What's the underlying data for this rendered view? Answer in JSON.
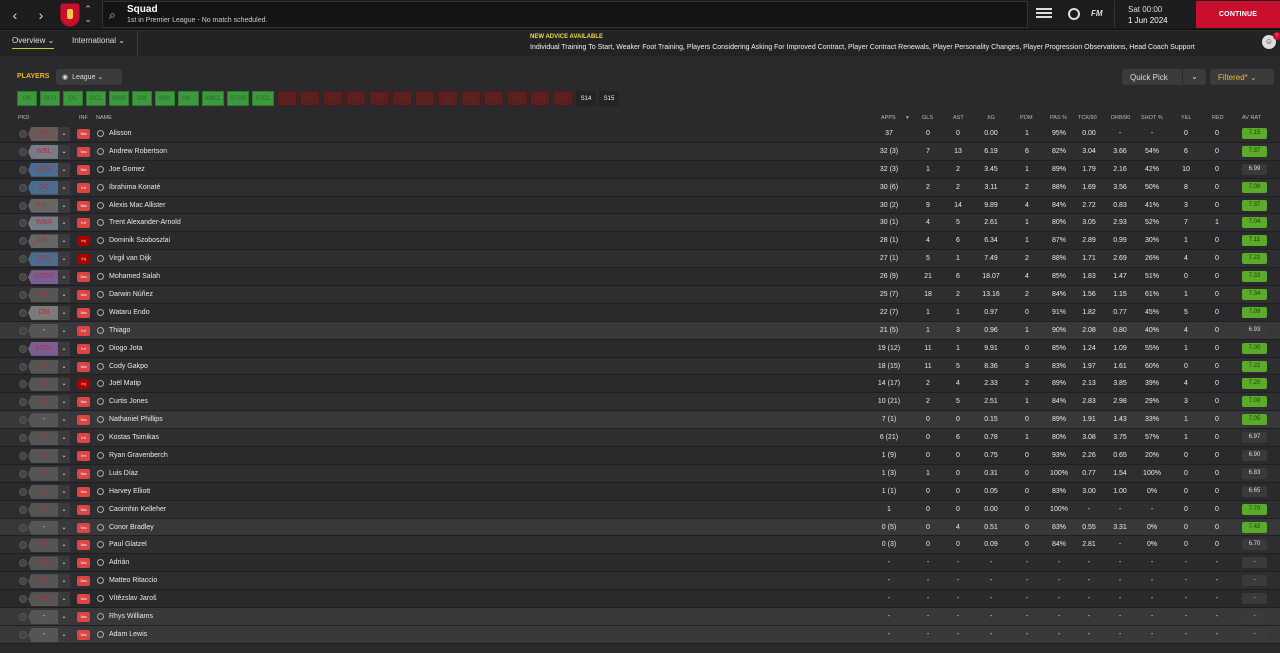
{
  "topbar": {
    "title": "Squad",
    "subtitle": "1st in Premier League - No match scheduled.",
    "time": "Sat 00:00",
    "date": "1 Jun 2024",
    "continue_label": "CONTINUE",
    "fm_label": "FM"
  },
  "subbar": {
    "tab_overview": "Overview ⌄",
    "tab_international": "International ⌄",
    "advice_title": "NEW ADVICE AVAILABLE",
    "advice_text": "Individual Training To Start, Weaker Foot Training, Players Considering Asking For Improved Contract, Player Contract Renewals, Player Personality Changes, Player Progression Observations, Head Coach Support"
  },
  "filters": {
    "players_label": "PLAYERS",
    "league_label": "League ⌄",
    "quick_pick": "Quick Pick",
    "filtered": "Filtered* ⌄",
    "positions": [
      "GK",
      "DCR",
      "DC",
      "DCL",
      "WBR",
      "DM",
      "WBL",
      "AM...",
      "AMCL",
      "STCR",
      "STCL",
      "S1",
      "S2",
      "S3",
      "S4",
      "S5",
      "S6",
      "S7",
      "S8",
      "S9",
      "S10",
      "S11",
      "S12",
      "S13",
      "S14",
      "S15"
    ]
  },
  "columns": {
    "pkd": "PKD",
    "inf": "INF",
    "name": "NAME",
    "apps": "APPS",
    "gls": "GLS",
    "ast": "AST",
    "xg": "XG",
    "pom": "POM",
    "pas": "PAS %",
    "tck": "TCK/90",
    "drb": "DRB/90",
    "shot": "SHOT %",
    "yel": "YEL",
    "red": "RED",
    "avrat": "AV RAT"
  },
  "colors": {
    "rating_good": "#5aab2a",
    "accent_red": "#c8102e",
    "accent_yellow": "#e6b822"
  },
  "rows": [
    {
      "pos": "GK",
      "inf": "Vac",
      "name": "Alisson",
      "apps": "37",
      "gls": "0",
      "ast": "0",
      "xg": "0.00",
      "pom": "1",
      "pas": "95%",
      "tck": "0.00",
      "drb": "-",
      "shot": "-",
      "yel": "0",
      "red": "0",
      "rat": "7.15"
    },
    {
      "pos": "WBL",
      "inf": "Vac",
      "name": "Andrew Robertson",
      "apps": "32 (3)",
      "gls": "7",
      "ast": "13",
      "xg": "6.19",
      "pom": "6",
      "pas": "82%",
      "tck": "3.04",
      "drb": "3.66",
      "shot": "54%",
      "yel": "6",
      "red": "0",
      "rat": "7.37"
    },
    {
      "pos": "DCR",
      "inf": "Vac",
      "name": "Joe Gomez",
      "apps": "32 (3)",
      "gls": "1",
      "ast": "2",
      "xg": "3.45",
      "pom": "1",
      "pas": "89%",
      "tck": "1.79",
      "drb": "2.16",
      "shot": "42%",
      "yel": "10",
      "red": "0",
      "rat": "6.99"
    },
    {
      "pos": "DC",
      "inf": "Int",
      "name": "Ibrahima Konaté",
      "apps": "30 (6)",
      "gls": "2",
      "ast": "2",
      "xg": "3.11",
      "pom": "2",
      "pas": "88%",
      "tck": "1.69",
      "drb": "3.56",
      "shot": "50%",
      "yel": "8",
      "red": "0",
      "rat": "7.08"
    },
    {
      "pos": "AM...",
      "inf": "Vac",
      "name": "Alexis Mac Allister",
      "apps": "30 (2)",
      "gls": "9",
      "ast": "14",
      "xg": "9.89",
      "pom": "4",
      "pas": "84%",
      "tck": "2.72",
      "drb": "0.83",
      "shot": "41%",
      "yel": "3",
      "red": "0",
      "rat": "7.37"
    },
    {
      "pos": "WBR",
      "inf": "Int",
      "name": "Trent Alexander-Arnold",
      "apps": "30 (1)",
      "gls": "4",
      "ast": "5",
      "xg": "2.61",
      "pom": "1",
      "pas": "80%",
      "tck": "3.05",
      "drb": "2.93",
      "shot": "52%",
      "yel": "7",
      "red": "1",
      "rat": "7.04"
    },
    {
      "pos": "AM...",
      "inf": "Inj",
      "name": "Dominik Szoboszlai",
      "apps": "28 (1)",
      "gls": "4",
      "ast": "6",
      "xg": "6.34",
      "pom": "1",
      "pas": "87%",
      "tck": "2.89",
      "drb": "0.99",
      "shot": "30%",
      "yel": "1",
      "red": "0",
      "rat": "7.11"
    },
    {
      "pos": "DCL",
      "inf": "Inj",
      "name": "Virgil van Dijk",
      "apps": "27 (1)",
      "gls": "5",
      "ast": "1",
      "xg": "7.49",
      "pom": "2",
      "pas": "88%",
      "tck": "1.71",
      "drb": "2.69",
      "shot": "26%",
      "yel": "4",
      "red": "0",
      "rat": "7.21"
    },
    {
      "pos": "STCR",
      "inf": "Vac",
      "name": "Mohamed Salah",
      "apps": "26 (9)",
      "gls": "21",
      "ast": "6",
      "xg": "18.07",
      "pom": "4",
      "pas": "85%",
      "tck": "1.83",
      "drb": "1.47",
      "shot": "51%",
      "yel": "0",
      "red": "0",
      "rat": "7.33"
    },
    {
      "pos": "S1",
      "inf": "Vac",
      "name": "Darwin Núñez",
      "apps": "25 (7)",
      "gls": "18",
      "ast": "2",
      "xg": "13.16",
      "pom": "2",
      "pas": "84%",
      "tck": "1.56",
      "drb": "1.15",
      "shot": "61%",
      "yel": "1",
      "red": "0",
      "rat": "7.34"
    },
    {
      "pos": "DM",
      "inf": "Vac",
      "name": "Wataru Endo",
      "apps": "22 (7)",
      "gls": "1",
      "ast": "1",
      "xg": "0.97",
      "pom": "0",
      "pas": "91%",
      "tck": "1.82",
      "drb": "0.77",
      "shot": "45%",
      "yel": "5",
      "red": "0",
      "rat": "7.09"
    },
    {
      "pos": "-",
      "inf": "Int",
      "name": "Thiago",
      "apps": "21 (5)",
      "gls": "1",
      "ast": "3",
      "xg": "0.96",
      "pom": "1",
      "pas": "90%",
      "tck": "2.08",
      "drb": "0.80",
      "shot": "40%",
      "yel": "4",
      "red": "0",
      "rat": "6.93"
    },
    {
      "pos": "STCL",
      "inf": "Int",
      "name": "Diogo Jota",
      "apps": "19 (12)",
      "gls": "11",
      "ast": "1",
      "xg": "9.91",
      "pom": "0",
      "pas": "85%",
      "tck": "1.24",
      "drb": "1.09",
      "shot": "55%",
      "yel": "1",
      "red": "0",
      "rat": "7.00"
    },
    {
      "pos": "S2",
      "inf": "Vac",
      "name": "Cody Gakpo",
      "apps": "18 (15)",
      "gls": "11",
      "ast": "5",
      "xg": "8.36",
      "pom": "3",
      "pas": "83%",
      "tck": "1.97",
      "drb": "1.61",
      "shot": "60%",
      "yel": "0",
      "red": "0",
      "rat": "7.22"
    },
    {
      "pos": "S3",
      "inf": "Inj",
      "name": "Joël Matip",
      "apps": "14 (17)",
      "gls": "2",
      "ast": "4",
      "xg": "2.33",
      "pom": "2",
      "pas": "89%",
      "tck": "2.13",
      "drb": "3.85",
      "shot": "39%",
      "yel": "4",
      "red": "0",
      "rat": "7.20"
    },
    {
      "pos": "S4",
      "inf": "Vac",
      "name": "Curtis Jones",
      "apps": "10 (21)",
      "gls": "2",
      "ast": "5",
      "xg": "2.51",
      "pom": "1",
      "pas": "84%",
      "tck": "2.83",
      "drb": "2.98",
      "shot": "29%",
      "yel": "3",
      "red": "0",
      "rat": "7.03"
    },
    {
      "pos": "-",
      "inf": "Vac",
      "name": "Nathaniel Phillips",
      "apps": "7 (1)",
      "gls": "0",
      "ast": "0",
      "xg": "0.15",
      "pom": "0",
      "pas": "89%",
      "tck": "1.91",
      "drb": "1.43",
      "shot": "33%",
      "yel": "1",
      "red": "0",
      "rat": "7.05"
    },
    {
      "pos": "S5",
      "inf": "Int",
      "name": "Kostas Tsimikas",
      "apps": "6 (21)",
      "gls": "0",
      "ast": "6",
      "xg": "0.78",
      "pom": "1",
      "pas": "80%",
      "tck": "3.08",
      "drb": "3.75",
      "shot": "57%",
      "yel": "1",
      "red": "0",
      "rat": "6.97"
    },
    {
      "pos": "S6",
      "inf": "Int",
      "name": "Ryan Gravenberch",
      "apps": "1 (9)",
      "gls": "0",
      "ast": "0",
      "xg": "0.75",
      "pom": "0",
      "pas": "93%",
      "tck": "2.26",
      "drb": "0.65",
      "shot": "20%",
      "yel": "0",
      "red": "0",
      "rat": "6.90"
    },
    {
      "pos": "S7",
      "inf": "Vac",
      "name": "Luis Díaz",
      "apps": "1 (3)",
      "gls": "1",
      "ast": "0",
      "xg": "0.31",
      "pom": "0",
      "pas": "100%",
      "tck": "0.77",
      "drb": "1.54",
      "shot": "100%",
      "yel": "0",
      "red": "0",
      "rat": "6.83"
    },
    {
      "pos": "S8",
      "inf": "Vac",
      "name": "Harvey Elliott",
      "apps": "1 (1)",
      "gls": "0",
      "ast": "0",
      "xg": "0.05",
      "pom": "0",
      "pas": "83%",
      "tck": "3.00",
      "drb": "1.00",
      "shot": "0%",
      "yel": "0",
      "red": "0",
      "rat": "6.65"
    },
    {
      "pos": "S9",
      "inf": "Vac",
      "name": "Caoimhin Kelleher",
      "apps": "1",
      "gls": "0",
      "ast": "0",
      "xg": "0.00",
      "pom": "0",
      "pas": "100%",
      "tck": "-",
      "drb": "-",
      "shot": "-",
      "yel": "0",
      "red": "0",
      "rat": "7.70"
    },
    {
      "pos": "-",
      "inf": "Vac",
      "name": "Conor Bradley",
      "apps": "0 (5)",
      "gls": "0",
      "ast": "4",
      "xg": "0.51",
      "pom": "0",
      "pas": "83%",
      "tck": "0.55",
      "drb": "3.31",
      "shot": "0%",
      "yel": "0",
      "red": "0",
      "rat": "7.42"
    },
    {
      "pos": "S10",
      "inf": "Vac",
      "name": "Paul Glatzel",
      "apps": "0 (3)",
      "gls": "0",
      "ast": "0",
      "xg": "0.09",
      "pom": "0",
      "pas": "84%",
      "tck": "2.81",
      "drb": "-",
      "shot": "0%",
      "yel": "0",
      "red": "0",
      "rat": "6.70"
    },
    {
      "pos": "S11",
      "inf": "Vac",
      "name": "Adrián",
      "apps": "-",
      "gls": "-",
      "ast": "-",
      "xg": "-",
      "pom": "-",
      "pas": "-",
      "tck": "-",
      "drb": "-",
      "shot": "-",
      "yel": "-",
      "red": "-",
      "rat": "-"
    },
    {
      "pos": "S12",
      "inf": "Vac",
      "name": "Matteo Ritaccio",
      "apps": "-",
      "gls": "-",
      "ast": "-",
      "xg": "-",
      "pom": "-",
      "pas": "-",
      "tck": "-",
      "drb": "-",
      "shot": "-",
      "yel": "-",
      "red": "-",
      "rat": "-"
    },
    {
      "pos": "S13",
      "inf": "Vac",
      "name": "Vítězslav Jaroš",
      "apps": "-",
      "gls": "-",
      "ast": "-",
      "xg": "-",
      "pom": "-",
      "pas": "-",
      "tck": "-",
      "drb": "-",
      "shot": "-",
      "yel": "-",
      "red": "-",
      "rat": "-"
    },
    {
      "pos": "-",
      "inf": "Vac",
      "name": "Rhys Williams",
      "apps": "-",
      "gls": "-",
      "ast": "-",
      "xg": "-",
      "pom": "-",
      "pas": "-",
      "tck": "-",
      "drb": "-",
      "shot": "-",
      "yel": "-",
      "red": "-",
      "rat": "-"
    },
    {
      "pos": "-",
      "inf": "Vac",
      "name": "Adam Lewis",
      "apps": "-",
      "gls": "-",
      "ast": "-",
      "xg": "-",
      "pom": "-",
      "pas": "-",
      "tck": "-",
      "drb": "-",
      "shot": "-",
      "yel": "-",
      "red": "-",
      "rat": "-"
    }
  ]
}
